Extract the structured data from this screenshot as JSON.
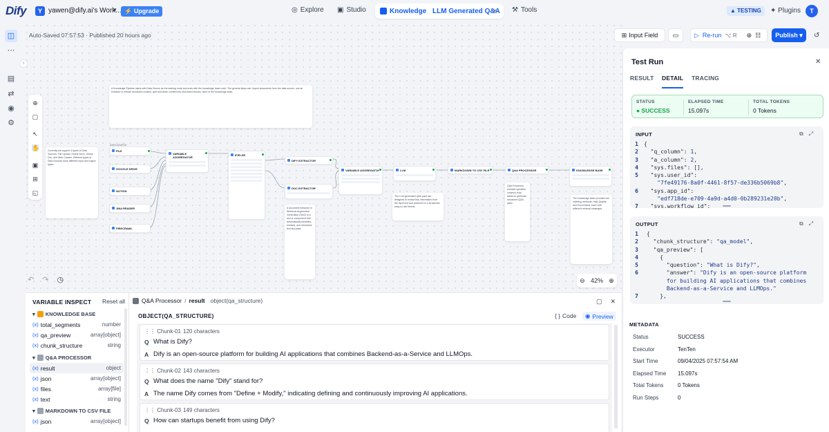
{
  "topbar": {
    "logo": "Dify",
    "workspace_initial": "Y",
    "workspace_name": "yawen@dify.ai's Work...",
    "upgrade": "Upgrade",
    "nav_explore": "Explore",
    "nav_studio": "Studio",
    "nav_knowledge": "Knowledge",
    "nav_knowledge_sub": "LLM Generated Q&A",
    "nav_tools": "Tools",
    "testing_badge": "TESTING",
    "plugins": "Plugins",
    "user_initial": "T"
  },
  "toolbar": {
    "autosaved": "Auto-Saved 07:57:53 · Published 20 hours ago",
    "input_field": "Input Field",
    "rerun": "Re-run",
    "rerun_shortcut": "⌥ R",
    "publish": "Publish"
  },
  "canvas": {
    "zoom": "42%",
    "nodes": {
      "file": "FILE",
      "google_drive": "GOOGLE DRIVE",
      "notion": "NOTION",
      "jina_reader": "JINA READER",
      "firecrawl": "FIRECRAWL",
      "var_agg1": "VARIABLE AGGREGATOR",
      "ifelse": "IF/ELSE",
      "dify_extractor": "DIFY EXTRACTOR",
      "doc_extractor": "DOC EXTRACTOR",
      "var_agg2": "VARIABLE AGGREGATOR",
      "llm": "LLM",
      "md_csv": "MARKDOWN TO CSV FILE",
      "qa_processor": "Q&A PROCESSOR",
      "knowledge_base": "KNOWLEDGE BASE"
    }
  },
  "var_inspect": {
    "title": "VARIABLE INSPECT",
    "reset_all": "Reset all",
    "groups": [
      {
        "name": "KNOWLEDGE BASE",
        "items": [
          {
            "name": "total_segments",
            "type": "number"
          },
          {
            "name": "qa_preview",
            "type": "array[object]"
          },
          {
            "name": "chunk_structure",
            "type": "string"
          }
        ]
      },
      {
        "name": "Q&A PROCESSOR",
        "items": [
          {
            "name": "result",
            "type": "object"
          },
          {
            "name": "json",
            "type": "array[object]"
          },
          {
            "name": "files",
            "type": "array[file]"
          },
          {
            "name": "text",
            "type": "string"
          }
        ]
      },
      {
        "name": "MARKDOWN TO CSV FILE",
        "items": [
          {
            "name": "json",
            "type": "array[object]"
          }
        ]
      }
    ],
    "x_marker": "(x)",
    "header_node": "Q&A Processor",
    "header_sep": "/",
    "header_var": "result",
    "header_type": "object(qa_structure)",
    "object_label": "OBJECT(QA_STRUCTURE)",
    "code_btn": "Code",
    "preview_btn": "Preview",
    "q_label": "Q",
    "a_label": "A",
    "chunks": [
      {
        "id": "Chunk-01",
        "chars": "120 characters",
        "q": "What is Dify?",
        "a": "Dify is an open-source platform for building AI applications that combines Backend-as-a-Service and LLMOps."
      },
      {
        "id": "Chunk-02",
        "chars": "143 characters",
        "q": "What does the name \"Dify\" stand for?",
        "a": "The name Dify comes from \"Define + Modify,\" indicating defining and continuously improving AI applications."
      },
      {
        "id": "Chunk-03",
        "chars": "149 characters",
        "q": "How can startups benefit from using Dify?",
        "a": ""
      }
    ]
  },
  "test_run": {
    "title": "Test Run",
    "tabs": [
      "RESULT",
      "DETAIL",
      "TRACING"
    ],
    "status_label": "STATUS",
    "status_value": "SUCCESS",
    "elapsed_label": "ELAPSED TIME",
    "elapsed_value": "15.097s",
    "tokens_label": "TOTAL TOKENS",
    "tokens_value": "0 Tokens",
    "input_title": "INPUT",
    "output_title": "OUTPUT",
    "metadata_title": "METADATA",
    "metadata": [
      {
        "k": "Status",
        "v": "SUCCESS"
      },
      {
        "k": "Executor",
        "v": "TenTen"
      },
      {
        "k": "Start Time",
        "v": "09/04/2025 07:57:54 AM"
      },
      {
        "k": "Elapsed Time",
        "v": "15.097s"
      },
      {
        "k": "Total Tokens",
        "v": "0 Tokens"
      },
      {
        "k": "Run Steps",
        "v": "0"
      }
    ]
  }
}
